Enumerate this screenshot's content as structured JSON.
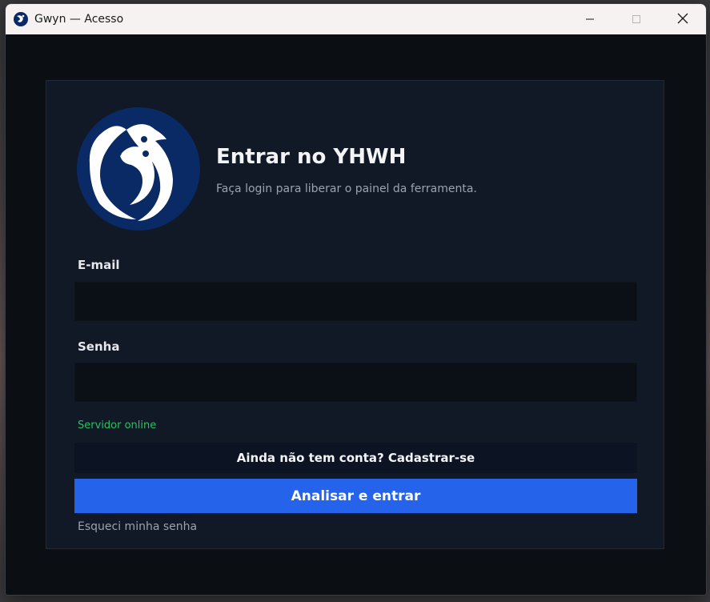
{
  "window": {
    "title": "Gwyn — Acesso",
    "controls": {
      "minimize": "minimize-icon",
      "maximize": "maximize-icon",
      "close": "close-icon"
    }
  },
  "login": {
    "heading": "Entrar no YHWH",
    "subheading": "Faça login para liberar o painel da ferramenta.",
    "email_label": "E-mail",
    "email_value": "",
    "email_placeholder": "",
    "password_label": "Senha",
    "password_value": "",
    "password_placeholder": "",
    "server_status": "Servidor online",
    "signup_label": "Ainda não tem conta? Cadastrar-se",
    "submit_label": "Analisar e entrar",
    "forgot_label": "Esqueci minha senha"
  },
  "colors": {
    "accent": "#2563eb",
    "status_online": "#22c55e",
    "logo_bg": "#0a2a66"
  }
}
